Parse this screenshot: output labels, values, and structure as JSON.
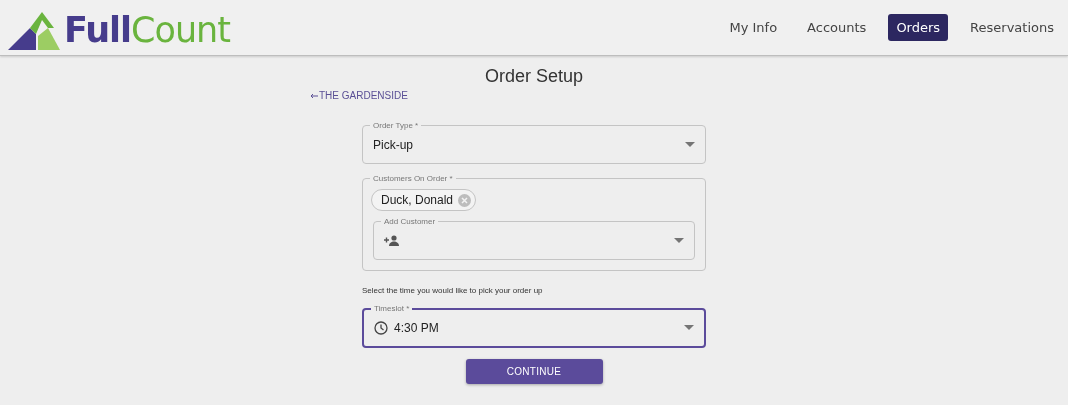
{
  "header": {
    "logo": {
      "first": "Full",
      "second": "Count"
    },
    "nav": [
      {
        "label": "My Info",
        "selected": false
      },
      {
        "label": "Accounts",
        "selected": false
      },
      {
        "label": "Orders",
        "selected": true
      },
      {
        "label": "Reservations",
        "selected": false
      }
    ]
  },
  "page": {
    "title": "Order Setup",
    "back_link": "THE GARDENSIDE",
    "order_type": {
      "label": "Order Type *",
      "value": "Pick-up",
      "focused": false
    },
    "customers": {
      "label": "Customers On Order *",
      "chips": [
        "Duck, Donald"
      ],
      "add_customer": {
        "label": "Add Customer",
        "focused": false
      }
    },
    "hint": "Select the time you would like to pick your order up",
    "timeslot": {
      "label": "Timeslot *",
      "value": "4:30 PM",
      "focused": true
    },
    "continue_button": "CONTINUE"
  }
}
